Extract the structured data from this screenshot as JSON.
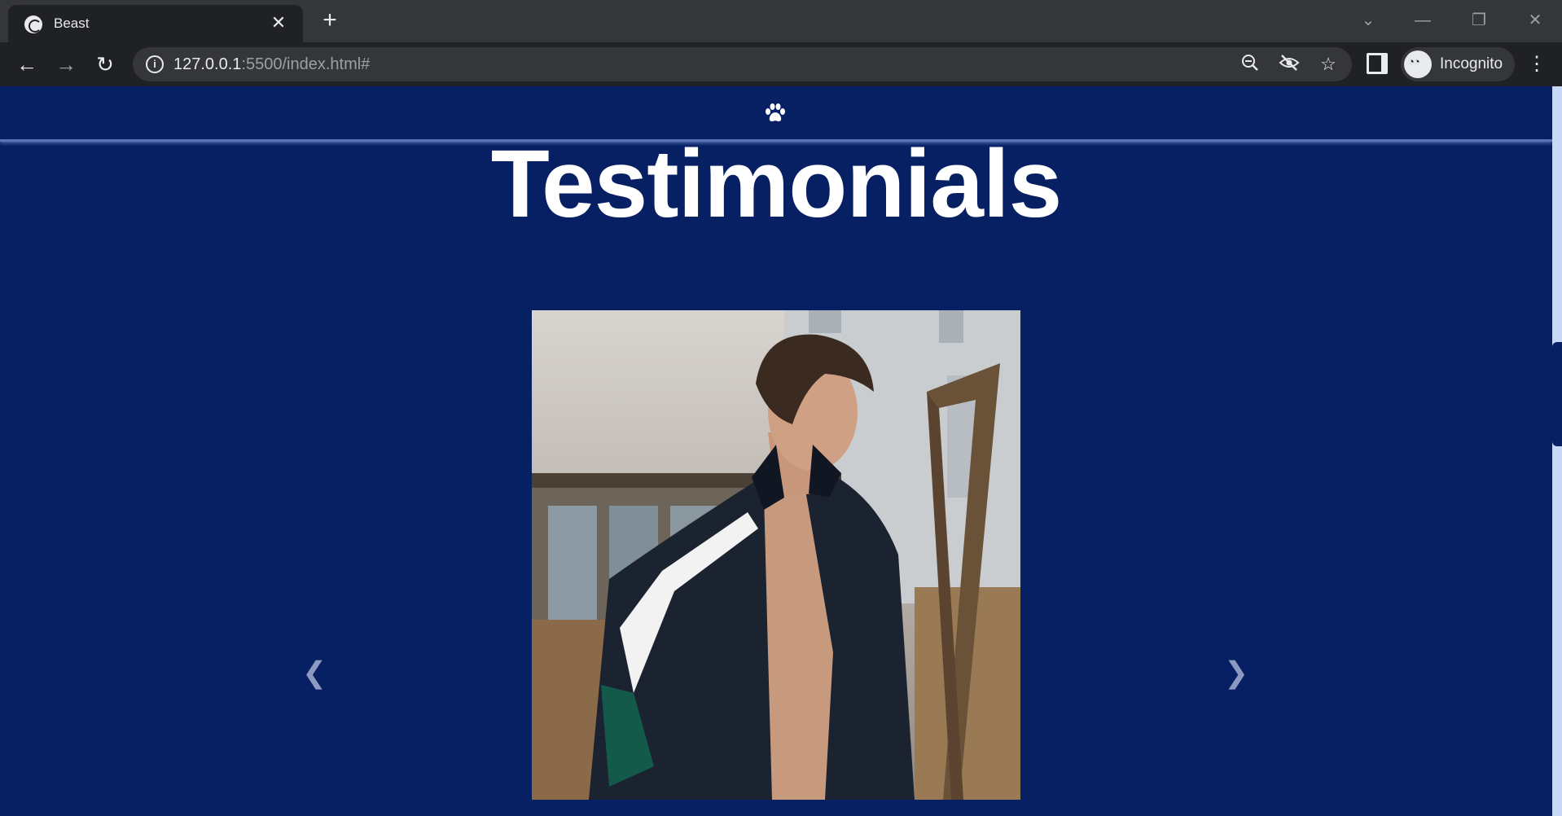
{
  "browser": {
    "tab_title": "Beast",
    "close_tab": "✕",
    "new_tab": "+",
    "url_host": "127.0.0.1",
    "url_rest": ":5500/index.html#",
    "profile_label": "Incognito",
    "icons": [
      "globe-icon",
      "back-icon",
      "forward-icon",
      "reload-icon",
      "info-icon",
      "zoom-out-icon",
      "eye-off-icon",
      "star-icon",
      "side-panel-icon",
      "incognito-icon",
      "menu-icon",
      "chevron-down-icon",
      "minimize-icon",
      "restore-icon",
      "close-window-icon"
    ]
  },
  "page": {
    "heading": "Testimonials",
    "prev_label": "❮",
    "next_label": "❯",
    "colors": {
      "background": "#071f63",
      "heading": "#ffffff",
      "arrow": "#8c9ac2"
    }
  }
}
